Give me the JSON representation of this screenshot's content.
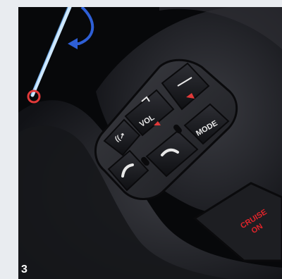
{
  "figure": {
    "number": "3"
  },
  "buttons": {
    "voice": "((↗",
    "volume": "VOL",
    "mode": "MODE",
    "cruise_line1": "CRUISE",
    "cruise_line2": "ON"
  },
  "colors": {
    "background": "#e9ecf0",
    "wheel_leather": "#1a1b1f",
    "panel": "#2a2b30",
    "button": "#16171b",
    "button_label": "#e8e8e8",
    "cruise_label": "#e0242a",
    "highlight_line": "#bfe4ff",
    "indicator_circle": "#e23a3a",
    "arrow_blue": "#2e5fd6"
  },
  "icons": [
    "voice-icon",
    "volume-up-icon",
    "volume-down-icon",
    "phone-pickup-icon",
    "phone-hangup-icon"
  ]
}
